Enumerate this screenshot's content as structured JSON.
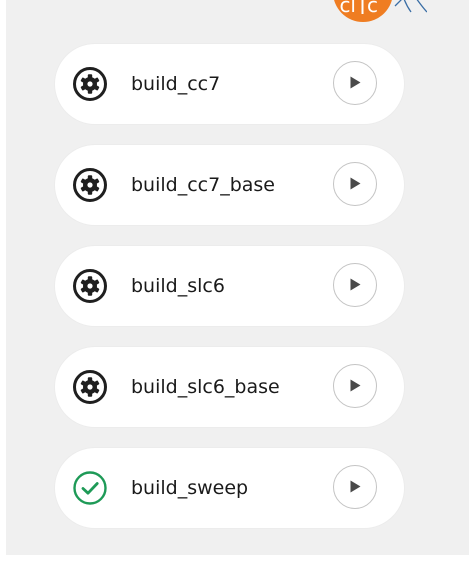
{
  "logo": {
    "text_left": "cl",
    "text_right": "c",
    "color": "#ef7d22"
  },
  "jobs": [
    {
      "name": "build_cc7",
      "status": "running",
      "status_icon": "gear-icon",
      "action": "play-icon"
    },
    {
      "name": "build_cc7_base",
      "status": "running",
      "status_icon": "gear-icon",
      "action": "play-icon"
    },
    {
      "name": "build_slc6",
      "status": "running",
      "status_icon": "gear-icon",
      "action": "play-icon"
    },
    {
      "name": "build_slc6_base",
      "status": "running",
      "status_icon": "gear-icon",
      "action": "play-icon"
    },
    {
      "name": "build_sweep",
      "status": "success",
      "status_icon": "check-circle-icon",
      "action": "play-icon"
    }
  ],
  "colors": {
    "running": "#1f1f1f",
    "success": "#1e9a57",
    "play": "#4a4a4a"
  }
}
